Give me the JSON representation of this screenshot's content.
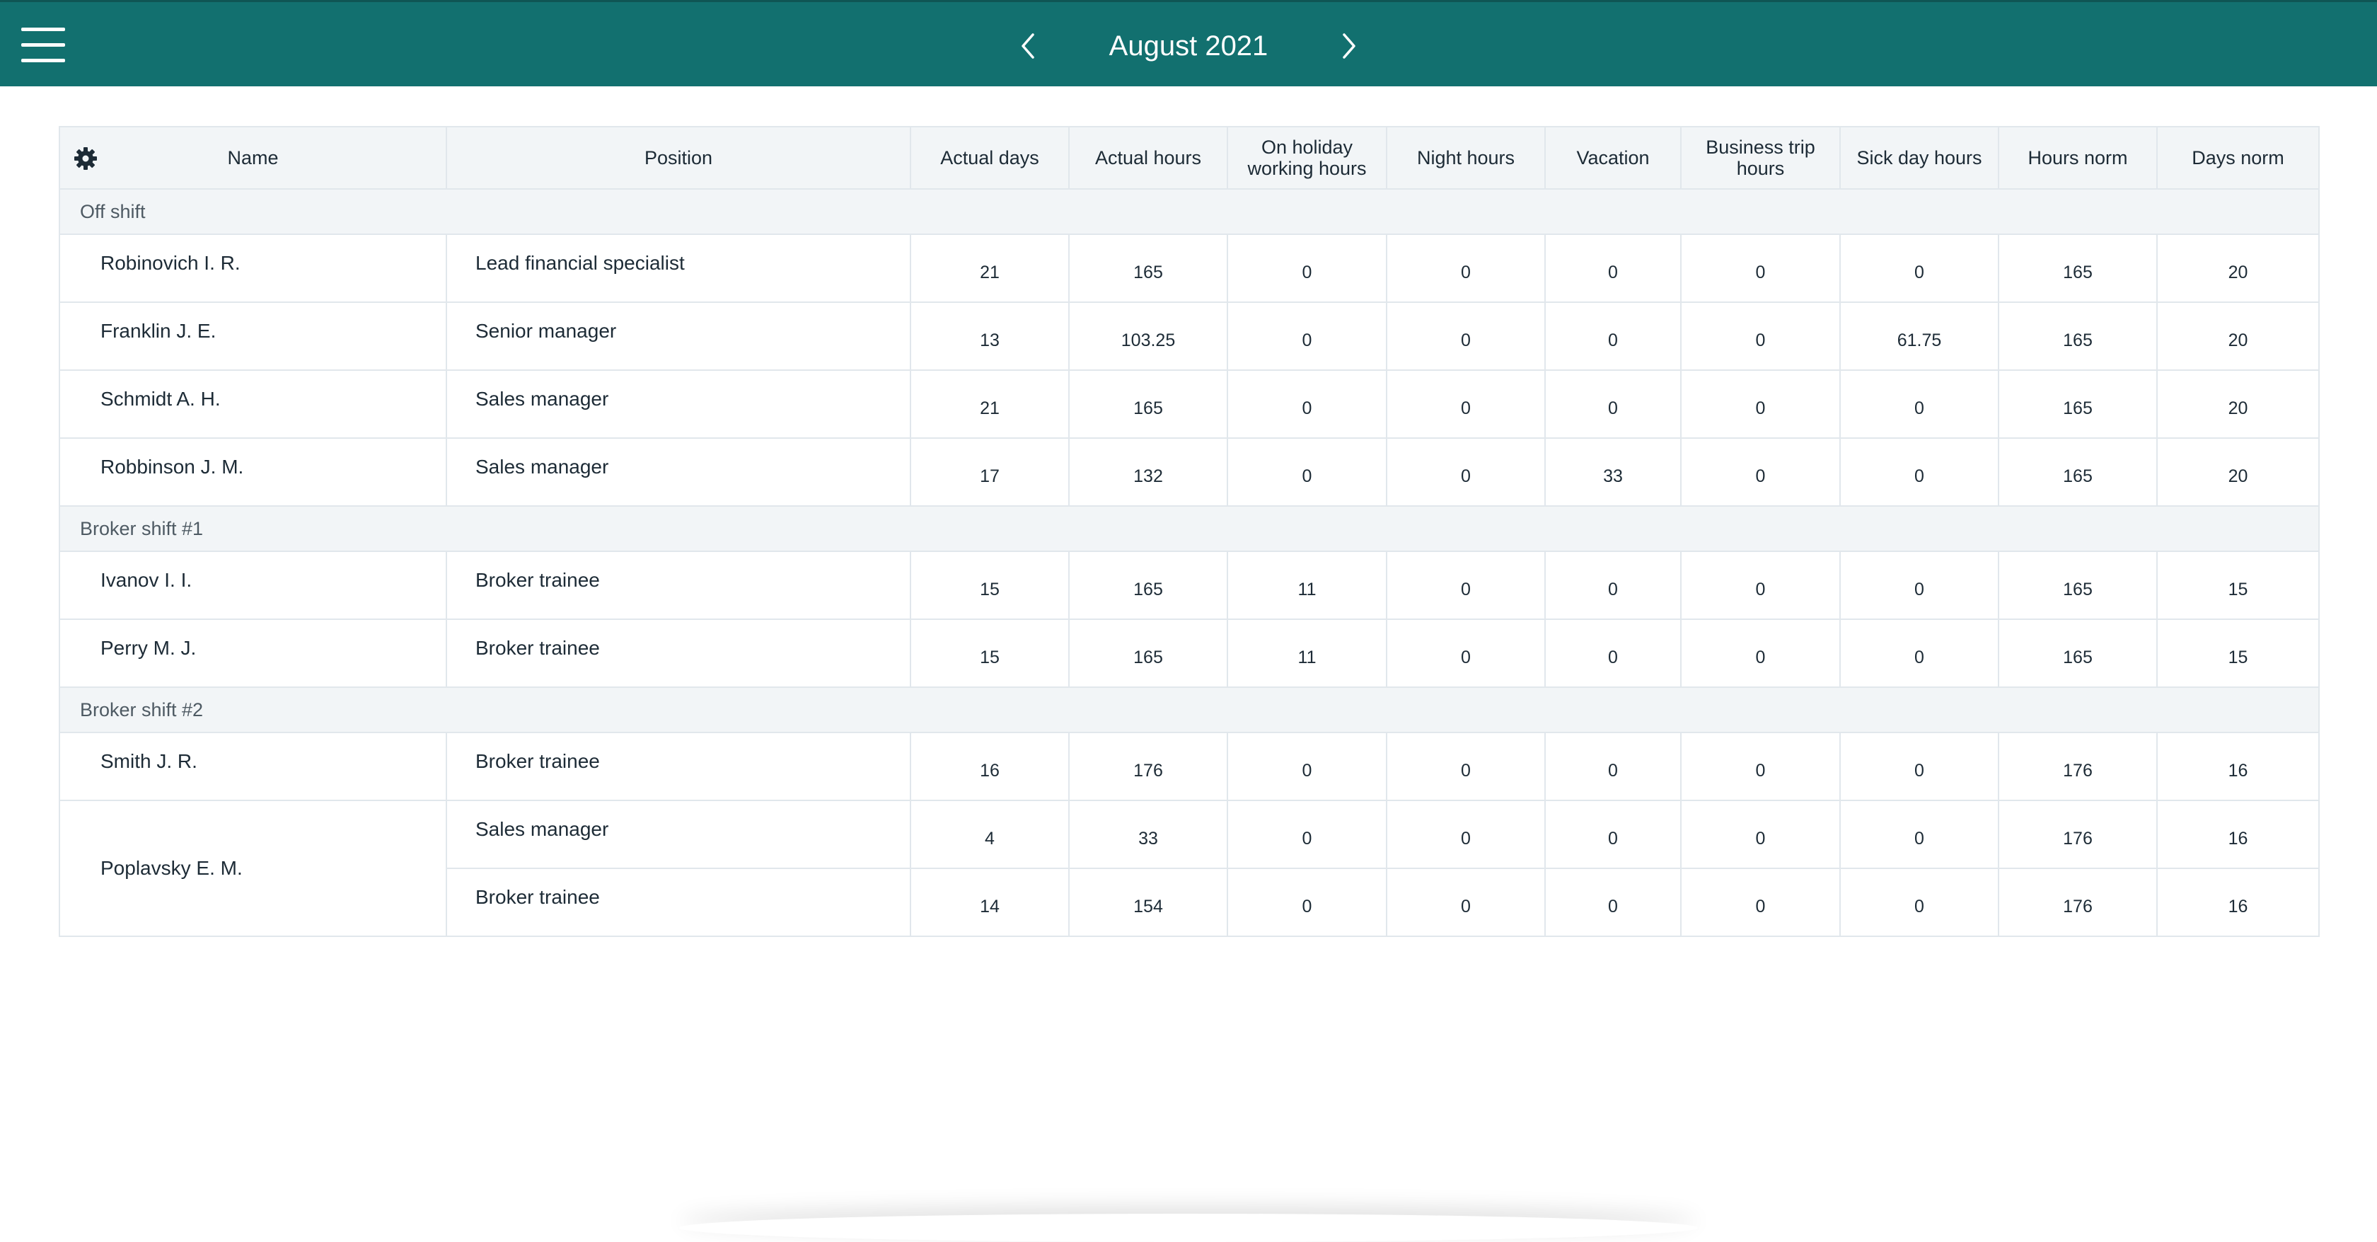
{
  "header": {
    "title": "August 2021",
    "accent_color": "#12706f"
  },
  "table": {
    "columns": [
      "Name",
      "Position",
      "Actual days",
      "Actual hours",
      "On holiday working hours",
      "Night hours",
      "Vacation",
      "Business trip hours",
      "Sick day hours",
      "Hours norm",
      "Days norm"
    ],
    "groups": [
      {
        "label": "Off shift",
        "rows": [
          {
            "name": "Robinovich I. R.",
            "position": "Lead financial specialist",
            "values": [
              "21",
              "165",
              "0",
              "0",
              "0",
              "0",
              "0",
              "165",
              "20"
            ]
          },
          {
            "name": "Franklin J. E.",
            "position": "Senior manager",
            "values": [
              "13",
              "103.25",
              "0",
              "0",
              "0",
              "0",
              "61.75",
              "165",
              "20"
            ]
          },
          {
            "name": "Schmidt A. H.",
            "position": "Sales manager",
            "values": [
              "21",
              "165",
              "0",
              "0",
              "0",
              "0",
              "0",
              "165",
              "20"
            ]
          },
          {
            "name": "Robbinson J. M.",
            "position": "Sales manager",
            "values": [
              "17",
              "132",
              "0",
              "0",
              "33",
              "0",
              "0",
              "165",
              "20"
            ]
          }
        ]
      },
      {
        "label": "Broker shift #1",
        "rows": [
          {
            "name": "Ivanov I. I.",
            "position": "Broker trainee",
            "values": [
              "15",
              "165",
              "11",
              "0",
              "0",
              "0",
              "0",
              "165",
              "15"
            ]
          },
          {
            "name": "Perry M. J.",
            "position": "Broker trainee",
            "values": [
              "15",
              "165",
              "11",
              "0",
              "0",
              "0",
              "0",
              "165",
              "15"
            ]
          }
        ]
      },
      {
        "label": "Broker shift #2",
        "rows": [
          {
            "name": "Smith J. R.",
            "position": "Broker trainee",
            "values": [
              "16",
              "176",
              "0",
              "0",
              "0",
              "0",
              "0",
              "176",
              "16"
            ]
          },
          {
            "name": "Poplavsky E. M.",
            "position": "Sales manager",
            "values": [
              "4",
              "33",
              "0",
              "0",
              "0",
              "0",
              "0",
              "176",
              "16"
            ]
          },
          {
            "name": "",
            "position": "Broker trainee",
            "values": [
              "14",
              "154",
              "0",
              "0",
              "0",
              "0",
              "0",
              "176",
              "16"
            ]
          }
        ]
      }
    ]
  }
}
